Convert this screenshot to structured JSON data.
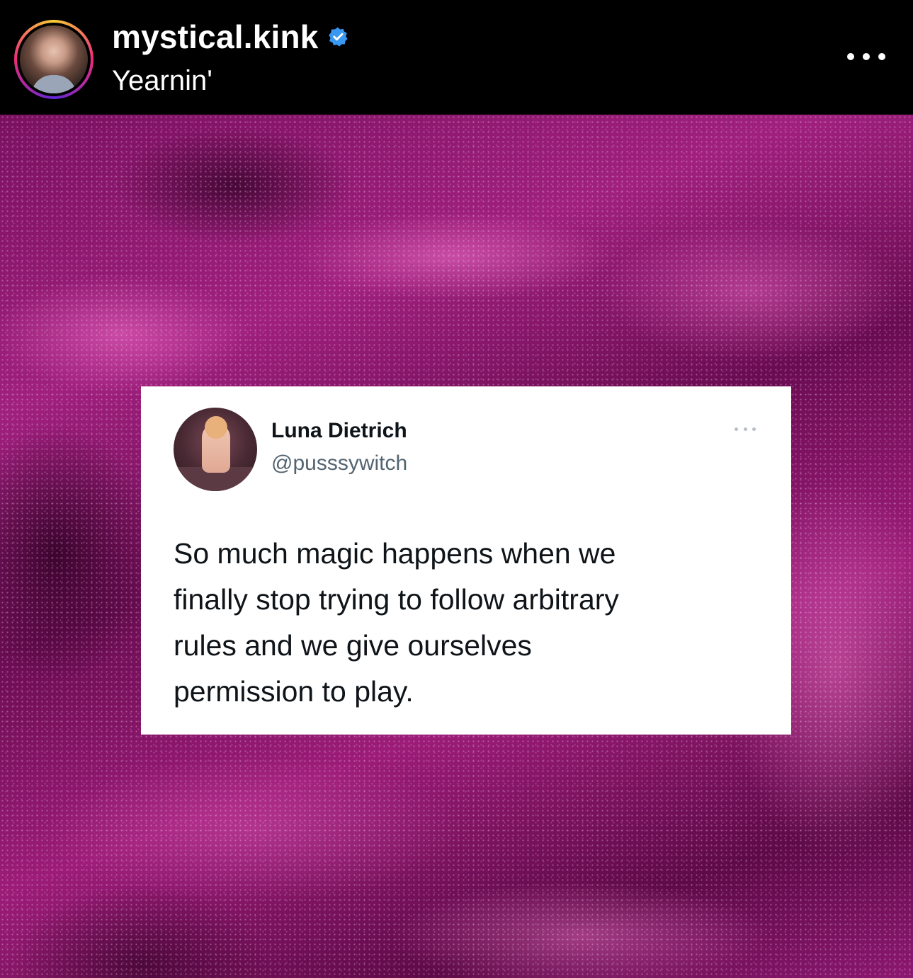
{
  "post_header": {
    "username": "mystical.kink",
    "verified": true,
    "subtitle": "Yearnin'",
    "more_icon": "more-horizontal-icon",
    "avatar_ring_colors": [
      "#f9ce34",
      "#ee2a7b",
      "#6228d7"
    ],
    "verified_color": "#3897f0"
  },
  "post_image": {
    "background": "pink velvet fabric",
    "tweet": {
      "display_name": "Luna Dietrich",
      "handle": "@pusssywitch",
      "text_lines": [
        "So much magic happens when we",
        "finally stop trying to follow arbitrary",
        "rules and we give ourselves",
        "permission to play."
      ]
    }
  }
}
